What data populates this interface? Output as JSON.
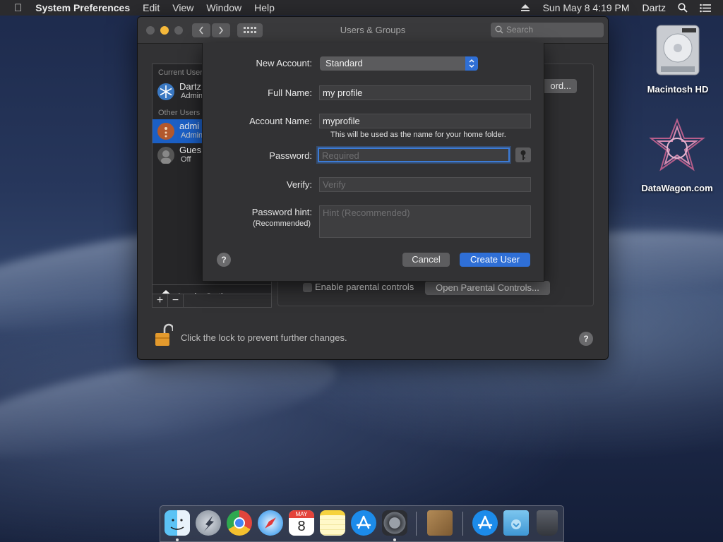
{
  "menubar": {
    "app_name": "System Preferences",
    "items": [
      "Edit",
      "View",
      "Window",
      "Help"
    ],
    "clock": "Sun May 8  4:19 PM",
    "user": "Dartz"
  },
  "window": {
    "title": "Users & Groups",
    "search_placeholder": "Search"
  },
  "sidebar": {
    "current_users_label": "Current User",
    "current_user": {
      "name": "Dartz",
      "role": "Admin"
    },
    "other_users_label": "Other Users",
    "other_users": [
      {
        "name": "admi",
        "role": "Admin"
      },
      {
        "name": "Gues",
        "role": "Off"
      }
    ],
    "login_options": "Login Options"
  },
  "content": {
    "password_button": "ord...",
    "parental_controls_label": "Enable parental controls",
    "open_parental_button": "Open Parental Controls...",
    "lock_text": "Click the lock to prevent further changes."
  },
  "sheet": {
    "new_account_label": "New Account:",
    "account_type": "Standard",
    "full_name_label": "Full Name:",
    "full_name_value": "my profile",
    "account_name_label": "Account Name:",
    "account_name_value": "myprofile",
    "home_folder_note": "This will be used as the name for your home folder.",
    "password_label": "Password:",
    "password_placeholder": "Required",
    "verify_label": "Verify:",
    "verify_placeholder": "Verify",
    "hint_label": "Password hint:",
    "hint_sublabel": "(Recommended)",
    "hint_placeholder": "Hint (Recommended)",
    "cancel_button": "Cancel",
    "create_button": "Create User"
  },
  "desktop": {
    "icons": [
      {
        "label": "Macintosh HD"
      },
      {
        "label": "DataWagon.com"
      }
    ]
  },
  "dock": {
    "items": [
      "finder-icon",
      "launchpad-icon",
      "chrome-icon",
      "safari-icon",
      "calendar-icon",
      "notes-icon",
      "app-store-icon",
      "system-preferences-icon",
      "contacts-icon",
      "app-store-folder-icon",
      "downloads-folder-icon",
      "trash-icon"
    ],
    "calendar_month": "MAY",
    "calendar_day": "8"
  }
}
